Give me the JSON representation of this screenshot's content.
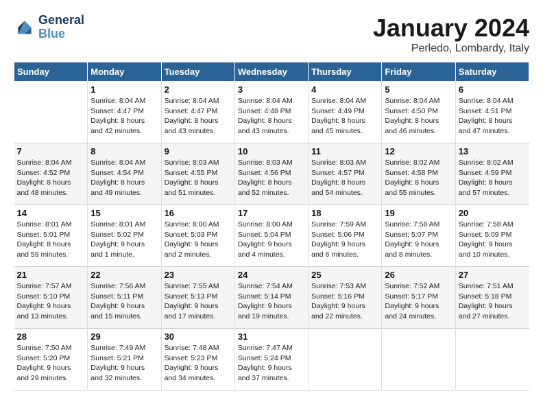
{
  "logo": {
    "line1": "General",
    "line2": "Blue"
  },
  "title": "January 2024",
  "location": "Perledo, Lombardy, Italy",
  "days_header": [
    "Sunday",
    "Monday",
    "Tuesday",
    "Wednesday",
    "Thursday",
    "Friday",
    "Saturday"
  ],
  "weeks": [
    [
      {
        "day": "",
        "info": ""
      },
      {
        "day": "1",
        "info": "Sunrise: 8:04 AM\nSunset: 4:47 PM\nDaylight: 8 hours\nand 42 minutes."
      },
      {
        "day": "2",
        "info": "Sunrise: 8:04 AM\nSunset: 4:47 PM\nDaylight: 8 hours\nand 43 minutes."
      },
      {
        "day": "3",
        "info": "Sunrise: 8:04 AM\nSunset: 4:48 PM\nDaylight: 8 hours\nand 43 minutes."
      },
      {
        "day": "4",
        "info": "Sunrise: 8:04 AM\nSunset: 4:49 PM\nDaylight: 8 hours\nand 45 minutes."
      },
      {
        "day": "5",
        "info": "Sunrise: 8:04 AM\nSunset: 4:50 PM\nDaylight: 8 hours\nand 46 minutes."
      },
      {
        "day": "6",
        "info": "Sunrise: 8:04 AM\nSunset: 4:51 PM\nDaylight: 8 hours\nand 47 minutes."
      }
    ],
    [
      {
        "day": "7",
        "info": "Sunrise: 8:04 AM\nSunset: 4:52 PM\nDaylight: 8 hours\nand 48 minutes."
      },
      {
        "day": "8",
        "info": "Sunrise: 8:04 AM\nSunset: 4:54 PM\nDaylight: 8 hours\nand 49 minutes."
      },
      {
        "day": "9",
        "info": "Sunrise: 8:03 AM\nSunset: 4:55 PM\nDaylight: 8 hours\nand 51 minutes."
      },
      {
        "day": "10",
        "info": "Sunrise: 8:03 AM\nSunset: 4:56 PM\nDaylight: 8 hours\nand 52 minutes."
      },
      {
        "day": "11",
        "info": "Sunrise: 8:03 AM\nSunset: 4:57 PM\nDaylight: 8 hours\nand 54 minutes."
      },
      {
        "day": "12",
        "info": "Sunrise: 8:02 AM\nSunset: 4:58 PM\nDaylight: 8 hours\nand 55 minutes."
      },
      {
        "day": "13",
        "info": "Sunrise: 8:02 AM\nSunset: 4:59 PM\nDaylight: 8 hours\nand 57 minutes."
      }
    ],
    [
      {
        "day": "14",
        "info": "Sunrise: 8:01 AM\nSunset: 5:01 PM\nDaylight: 8 hours\nand 59 minutes."
      },
      {
        "day": "15",
        "info": "Sunrise: 8:01 AM\nSunset: 5:02 PM\nDaylight: 9 hours\nand 1 minute."
      },
      {
        "day": "16",
        "info": "Sunrise: 8:00 AM\nSunset: 5:03 PM\nDaylight: 9 hours\nand 2 minutes."
      },
      {
        "day": "17",
        "info": "Sunrise: 8:00 AM\nSunset: 5:04 PM\nDaylight: 9 hours\nand 4 minutes."
      },
      {
        "day": "18",
        "info": "Sunrise: 7:59 AM\nSunset: 5:06 PM\nDaylight: 9 hours\nand 6 minutes."
      },
      {
        "day": "19",
        "info": "Sunrise: 7:58 AM\nSunset: 5:07 PM\nDaylight: 9 hours\nand 8 minutes."
      },
      {
        "day": "20",
        "info": "Sunrise: 7:58 AM\nSunset: 5:09 PM\nDaylight: 9 hours\nand 10 minutes."
      }
    ],
    [
      {
        "day": "21",
        "info": "Sunrise: 7:57 AM\nSunset: 5:10 PM\nDaylight: 9 hours\nand 13 minutes."
      },
      {
        "day": "22",
        "info": "Sunrise: 7:56 AM\nSunset: 5:11 PM\nDaylight: 9 hours\nand 15 minutes."
      },
      {
        "day": "23",
        "info": "Sunrise: 7:55 AM\nSunset: 5:13 PM\nDaylight: 9 hours\nand 17 minutes."
      },
      {
        "day": "24",
        "info": "Sunrise: 7:54 AM\nSunset: 5:14 PM\nDaylight: 9 hours\nand 19 minutes."
      },
      {
        "day": "25",
        "info": "Sunrise: 7:53 AM\nSunset: 5:16 PM\nDaylight: 9 hours\nand 22 minutes."
      },
      {
        "day": "26",
        "info": "Sunrise: 7:52 AM\nSunset: 5:17 PM\nDaylight: 9 hours\nand 24 minutes."
      },
      {
        "day": "27",
        "info": "Sunrise: 7:51 AM\nSunset: 5:18 PM\nDaylight: 9 hours\nand 27 minutes."
      }
    ],
    [
      {
        "day": "28",
        "info": "Sunrise: 7:50 AM\nSunset: 5:20 PM\nDaylight: 9 hours\nand 29 minutes."
      },
      {
        "day": "29",
        "info": "Sunrise: 7:49 AM\nSunset: 5:21 PM\nDaylight: 9 hours\nand 32 minutes."
      },
      {
        "day": "30",
        "info": "Sunrise: 7:48 AM\nSunset: 5:23 PM\nDaylight: 9 hours\nand 34 minutes."
      },
      {
        "day": "31",
        "info": "Sunrise: 7:47 AM\nSunset: 5:24 PM\nDaylight: 9 hours\nand 37 minutes."
      },
      {
        "day": "",
        "info": ""
      },
      {
        "day": "",
        "info": ""
      },
      {
        "day": "",
        "info": ""
      }
    ]
  ]
}
